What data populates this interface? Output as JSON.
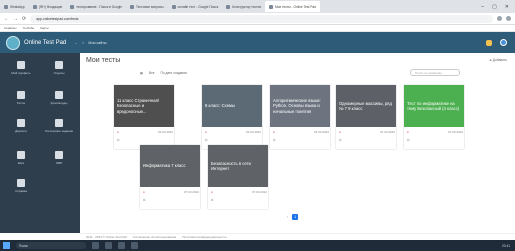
{
  "browser": {
    "tabs": [
      {
        "label": "WhatsApp",
        "active": false
      },
      {
        "label": "(99+) Входящие",
        "active": false
      },
      {
        "label": "тестирование - Поиск в Google",
        "active": false
      },
      {
        "label": "Тестовые вопросы",
        "active": false
      },
      {
        "label": "онлайн тест - Google Поиск",
        "active": false
      },
      {
        "label": "Конструктор тестов",
        "active": false
      },
      {
        "label": "Мои тесты - Online Test Pad",
        "active": true
      }
    ],
    "url": "app.onlinetestpad.com/tests",
    "bookmarks": [
      "Сервисы",
      "YouTube",
      "Карты"
    ]
  },
  "app": {
    "brand": "Online Test Pad",
    "breadcrumbs": [
      "Мои сайты"
    ]
  },
  "sidebar": {
    "items": [
      {
        "label": "Мой профиль",
        "icon": "user-icon"
      },
      {
        "label": "Отделы",
        "icon": "org-icon"
      },
      {
        "label": "Тесты",
        "icon": "test-icon"
      },
      {
        "label": "Кроссворды",
        "icon": "crossword-icon"
      },
      {
        "label": "Диалоги",
        "icon": "dialog-icon"
      },
      {
        "label": "Логические задания",
        "icon": "logic-icon"
      },
      {
        "label": "Квиз",
        "icon": "quiz-icon"
      },
      {
        "label": "ОВП",
        "icon": "survey-icon"
      },
      {
        "label": "Справка",
        "icon": "help-icon"
      }
    ]
  },
  "main": {
    "title": "Мои тесты",
    "add_label": "Добавить",
    "filters": [
      "Все",
      "По дате создания"
    ],
    "search_placeholder": "Поиск по названию",
    "cards": [
      {
        "title": "11 класс Страничная/Безопасные и вредоносные...",
        "color": "#4f4f4f",
        "date": "03.03.2022"
      },
      {
        "title": "8 класс: Схемы",
        "color": "#5b6a74",
        "date": "03.03.2022"
      },
      {
        "title": "Алгоритмические языки: Python. Основы языка и начальные понятия",
        "color": "#6d7480",
        "date": "03.03.2022"
      },
      {
        "title": "Одномерные массивы, ряд № 7 9 класс",
        "color": "#5d6066",
        "date": "07.03.2022"
      },
      {
        "title": "Тест по информатике на тему Безопасный (4 класс)",
        "color": "#4caf50",
        "date": "07.03.2022"
      },
      {
        "title": "Информатика 7 класс",
        "color": "#5f6266",
        "date": "07.03.2022"
      },
      {
        "title": "Безопасность в сети Интернет",
        "color": "#5f6266",
        "date": "07.03.2022"
      }
    ],
    "page_current": "1"
  },
  "footer": {
    "copyright": "2011 - 2024 © Online Test Pad",
    "links": [
      "Соглашение об использовании",
      "Политика конфиденциальности"
    ]
  },
  "taskbar": {
    "search_placeholder": "Поиск",
    "clock": "20:41"
  },
  "colors": {
    "appbar": "#2e5b78",
    "sidebar": "#2f3e4d",
    "accent": "#1a73e8"
  }
}
